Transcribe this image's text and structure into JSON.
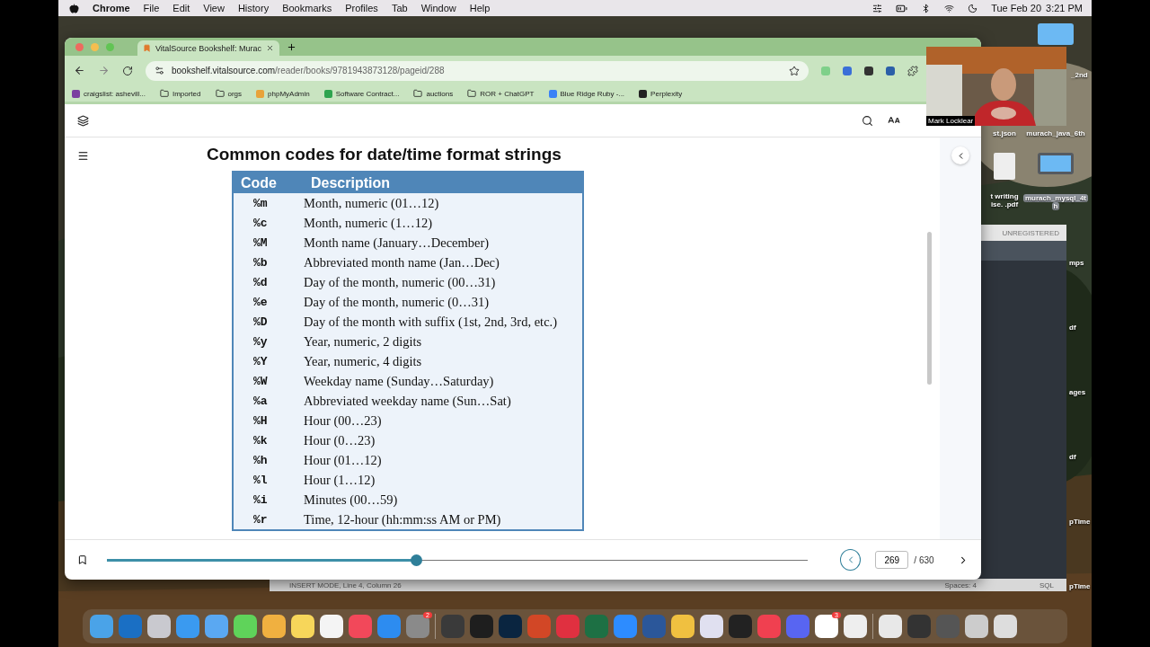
{
  "menu_bar": {
    "app": "Chrome",
    "menus": [
      "File",
      "Edit",
      "View",
      "History",
      "Bookmarks",
      "Profiles",
      "Tab",
      "Window",
      "Help"
    ],
    "date": "Tue Feb 20",
    "time": "3:21 PM"
  },
  "browser": {
    "tab_title": "VitalSource Bookshelf: Murac",
    "address": {
      "domain": "bookshelf.vitalsource.com",
      "path": "/reader/books/9781943873128/pageid/288"
    },
    "bookmarks": [
      {
        "kind": "site",
        "label": "craigslist: ashevill...",
        "color": "#7b3fa0"
      },
      {
        "kind": "folder",
        "label": "Imported"
      },
      {
        "kind": "folder",
        "label": "orgs"
      },
      {
        "kind": "site",
        "label": "phpMyAdmin",
        "color": "#e8a33a"
      },
      {
        "kind": "site",
        "label": "Software Contract...",
        "color": "#2ea44f"
      },
      {
        "kind": "folder",
        "label": "auctions"
      },
      {
        "kind": "folder",
        "label": "ROR + ChatGPT"
      },
      {
        "kind": "site",
        "label": "Blue Ridge Ruby -...",
        "color": "#3b82f6"
      },
      {
        "kind": "site",
        "label": "Perplexity",
        "color": "#222222"
      }
    ]
  },
  "reader": {
    "heading": "Common codes for date/time format strings",
    "table": {
      "columns": [
        "Code",
        "Description"
      ],
      "rows": [
        [
          "%m",
          "Month, numeric (01…12)"
        ],
        [
          "%c",
          "Month, numeric (1…12)"
        ],
        [
          "%M",
          "Month name (January…December)"
        ],
        [
          "%b",
          "Abbreviated month name (Jan…Dec)"
        ],
        [
          "%d",
          "Day of the month, numeric (00…31)"
        ],
        [
          "%e",
          "Day of the month, numeric (0…31)"
        ],
        [
          "%D",
          "Day of the month with suffix (1st, 2nd, 3rd, etc.)"
        ],
        [
          "%y",
          "Year, numeric, 2 digits"
        ],
        [
          "%Y",
          "Year, numeric, 4 digits"
        ],
        [
          "%W",
          "Weekday name (Sunday…Saturday)"
        ],
        [
          "%a",
          "Abbreviated weekday name (Sun…Sat)"
        ],
        [
          "%H",
          "Hour (00…23)"
        ],
        [
          "%k",
          "Hour (0…23)"
        ],
        [
          "%h",
          "Hour (01…12)"
        ],
        [
          "%l",
          "Hour (1…12)"
        ],
        [
          "%i",
          "Minutes (00…59)"
        ],
        [
          "%r",
          "Time, 12-hour (hh:mm:ss AM or PM)"
        ]
      ]
    },
    "progress": {
      "level": 0.44
    },
    "page": "269",
    "page_total": "/ 630"
  },
  "webcam": {
    "name": "Mark Locklear"
  },
  "editor": {
    "badge": "UNREGISTERED",
    "status": "INSERT MODE, Line 4, Column 26",
    "spaces": "Spaces: 4",
    "syntax": "SQL"
  },
  "desktop_icons": {
    "left": [
      {
        "kind": "label",
        "lines": [
          "st.json"
        ]
      },
      {
        "kind": "document",
        "lines": [
          "t writing",
          "ise. .pdf"
        ]
      }
    ],
    "right": [
      {
        "kind": "folder_edge",
        "lines": [
          "_2nd"
        ],
        "selected": false
      },
      {
        "kind": "label",
        "lines": [
          "murach_java_6th"
        ]
      },
      {
        "kind": "folder",
        "lines": [
          "murach_mysql_4t",
          "h"
        ],
        "selected": true
      },
      {
        "kind": "partial",
        "lines": [
          "mps"
        ]
      },
      {
        "kind": "partial",
        "lines": [
          "df"
        ]
      },
      {
        "kind": "partial",
        "lines": [
          "ages"
        ]
      },
      {
        "kind": "partial",
        "lines": [
          "df"
        ]
      },
      {
        "kind": "partial",
        "lines": [
          "pTime"
        ]
      },
      {
        "kind": "partial",
        "lines": [
          "pTime"
        ]
      }
    ]
  },
  "dock": {
    "apps": [
      {
        "color": "#4aa3e8"
      },
      {
        "color": "#1a6fc4"
      },
      {
        "color": "#c9c9cf"
      },
      {
        "color": "#3a9af0"
      },
      {
        "color": "#5aa8f2"
      },
      {
        "color": "#5fd35a"
      },
      {
        "color": "#f0b040"
      },
      {
        "color": "#f7d65a"
      },
      {
        "color": "#f4f4f4"
      },
      {
        "color": "#f2485a"
      },
      {
        "color": "#2d8cf0"
      },
      {
        "color": "#8a8a8a",
        "badge": "2"
      },
      {
        "color": "#3a3a3a"
      },
      {
        "color": "#1e1e1e"
      },
      {
        "color": "#0a2540"
      },
      {
        "color": "#d24726"
      },
      {
        "color": "#e03040"
      },
      {
        "color": "#1d7044"
      },
      {
        "color": "#2d8cff"
      },
      {
        "color": "#2b579a"
      },
      {
        "color": "#f0c040"
      },
      {
        "color": "#e0e0f0"
      },
      {
        "color": "#222222"
      },
      {
        "color": "#f04050"
      },
      {
        "color": "#5865f2"
      },
      {
        "color": "#ffffff",
        "badge": "3"
      },
      {
        "color": "#eeeeee"
      }
    ],
    "recent": [
      {
        "color": "#e8e8e8"
      },
      {
        "color": "#333333"
      },
      {
        "color": "#555555"
      },
      {
        "color": "#cccccc"
      },
      {
        "color": "#dddddd"
      }
    ]
  }
}
